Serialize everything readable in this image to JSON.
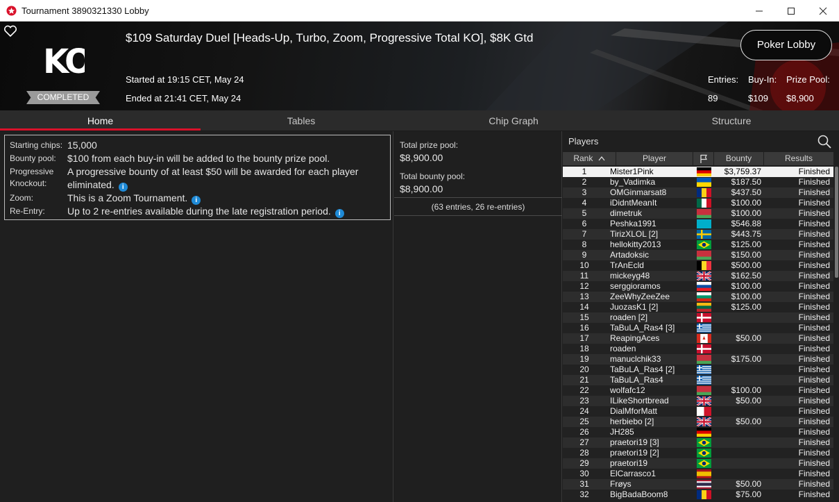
{
  "window": {
    "title": "Tournament 3890321330 Lobby"
  },
  "header": {
    "tournament_title": "$109 Saturday Duel [Heads-Up, Turbo, Zoom, Progressive Total KO], $8K Gtd",
    "status": "COMPLETED",
    "logo_text": "KO",
    "started": "Started at 19:15 CET, May 24",
    "ended": "Ended at 21:41 CET, May 24",
    "lobby_button": "Poker Lobby",
    "entries_label": "Entries:",
    "entries_value": "89",
    "buyin_label": "Buy-In:",
    "buyin_value": "$109",
    "prizepool_label": "Prize Pool:",
    "prizepool_value": "$8,900"
  },
  "tabs": [
    "Home",
    "Tables",
    "Chip Graph",
    "Structure"
  ],
  "info": {
    "starting_chips_label": "Starting chips:",
    "starting_chips_value": "15,000",
    "bounty_pool_label": "Bounty pool:",
    "bounty_pool_value": "$100 from each buy-in will be added to the bounty prize pool.",
    "progressive_label_1": "Progressive",
    "progressive_label_2": "Knockout:",
    "progressive_value_1": "A progressive bounty of at least $50 will be awarded for each player",
    "progressive_value_2": "eliminated.",
    "zoom_label": "Zoom:",
    "zoom_value": "This is a Zoom Tournament.",
    "reentry_label": "Re-Entry:",
    "reentry_value": "Up to 2 re-entries available during the late registration period."
  },
  "pools": {
    "total_prize_label": "Total prize pool:",
    "total_prize_value": "$8,900.00",
    "total_bounty_label": "Total bounty pool:",
    "total_bounty_value": "$8,900.00",
    "entries_note": "(63 entries, 26 re-entries)"
  },
  "players": {
    "title": "Players",
    "columns": {
      "rank": "Rank",
      "player": "Player",
      "bounty": "Bounty",
      "results": "Results"
    },
    "rows": [
      {
        "rank": "1",
        "name": "Mister1Pink",
        "flag": "de",
        "bounty": "$3,759.37",
        "result": "Finished"
      },
      {
        "rank": "2",
        "name": "by_Vadimka",
        "flag": "ua",
        "bounty": "$187.50",
        "result": "Finished"
      },
      {
        "rank": "3",
        "name": "OMGinmarsat8",
        "flag": "ro",
        "bounty": "$437.50",
        "result": "Finished"
      },
      {
        "rank": "4",
        "name": "iDidntMeanIt",
        "flag": "mx",
        "bounty": "$100.00",
        "result": "Finished"
      },
      {
        "rank": "5",
        "name": "dimetruk",
        "flag": "by",
        "bounty": "$100.00",
        "result": "Finished"
      },
      {
        "rank": "6",
        "name": "Peshka1991",
        "flag": "kz",
        "bounty": "$546.88",
        "result": "Finished"
      },
      {
        "rank": "7",
        "name": "TirizXLOL [2]",
        "flag": "se",
        "bounty": "$443.75",
        "result": "Finished"
      },
      {
        "rank": "8",
        "name": "hellokitty2013",
        "flag": "br",
        "bounty": "$125.00",
        "result": "Finished"
      },
      {
        "rank": "9",
        "name": "Artadoksic",
        "flag": "by",
        "bounty": "$150.00",
        "result": "Finished"
      },
      {
        "rank": "10",
        "name": "TrAnEcld",
        "flag": "be",
        "bounty": "$500.00",
        "result": "Finished"
      },
      {
        "rank": "11",
        "name": "mickeyg48",
        "flag": "gb",
        "bounty": "$162.50",
        "result": "Finished"
      },
      {
        "rank": "12",
        "name": "serggioramos",
        "flag": "sk",
        "bounty": "$100.00",
        "result": "Finished"
      },
      {
        "rank": "13",
        "name": "ZeeWhyZeeZee",
        "flag": "bg",
        "bounty": "$100.00",
        "result": "Finished"
      },
      {
        "rank": "14",
        "name": "JuozasK1 [2]",
        "flag": "lt",
        "bounty": "$125.00",
        "result": "Finished"
      },
      {
        "rank": "15",
        "name": "roaden [2]",
        "flag": "dk",
        "bounty": "",
        "result": "Finished"
      },
      {
        "rank": "16",
        "name": "TaBuLA_Ras4 [3]",
        "flag": "gr",
        "bounty": "",
        "result": "Finished"
      },
      {
        "rank": "17",
        "name": "ReapingAces",
        "flag": "ca",
        "bounty": "$50.00",
        "result": "Finished"
      },
      {
        "rank": "18",
        "name": "roaden",
        "flag": "dk",
        "bounty": "",
        "result": "Finished"
      },
      {
        "rank": "19",
        "name": "manuclchik33",
        "flag": "by",
        "bounty": "$175.00",
        "result": "Finished"
      },
      {
        "rank": "20",
        "name": "TaBuLA_Ras4 [2]",
        "flag": "gr",
        "bounty": "",
        "result": "Finished"
      },
      {
        "rank": "21",
        "name": "TaBuLA_Ras4",
        "flag": "gr",
        "bounty": "",
        "result": "Finished"
      },
      {
        "rank": "22",
        "name": "wolfafc12",
        "flag": "by",
        "bounty": "$100.00",
        "result": "Finished"
      },
      {
        "rank": "23",
        "name": "ILikeShortbread",
        "flag": "gb",
        "bounty": "$50.00",
        "result": "Finished"
      },
      {
        "rank": "24",
        "name": "DialMforMatt",
        "flag": "mt",
        "bounty": "",
        "result": "Finished"
      },
      {
        "rank": "25",
        "name": "herbiebo [2]",
        "flag": "gb",
        "bounty": "$50.00",
        "result": "Finished"
      },
      {
        "rank": "26",
        "name": "JH285",
        "flag": "de",
        "bounty": "",
        "result": "Finished"
      },
      {
        "rank": "27",
        "name": "praetori19 [3]",
        "flag": "br",
        "bounty": "",
        "result": "Finished"
      },
      {
        "rank": "28",
        "name": "praetori19 [2]",
        "flag": "br",
        "bounty": "",
        "result": "Finished"
      },
      {
        "rank": "29",
        "name": "praetori19",
        "flag": "br",
        "bounty": "",
        "result": "Finished"
      },
      {
        "rank": "30",
        "name": "ElCarrasco1",
        "flag": "es",
        "bounty": "",
        "result": "Finished"
      },
      {
        "rank": "31",
        "name": "Frøys",
        "flag": "th",
        "bounty": "$50.00",
        "result": "Finished"
      },
      {
        "rank": "32",
        "name": "BigBadaBoom8",
        "flag": "ro",
        "bounty": "$75.00",
        "result": "Finished"
      }
    ]
  },
  "colors": {
    "accent": "#d9112a",
    "info_icon": "#1f8ad6"
  }
}
